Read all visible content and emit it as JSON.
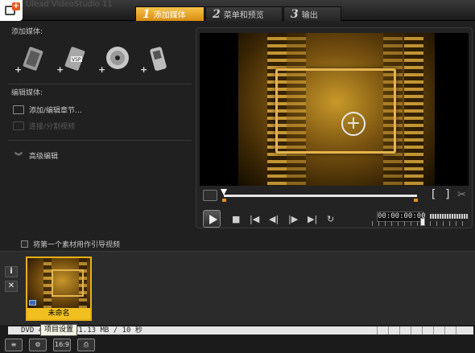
{
  "title_bar": {
    "app_title": "Ulead VideoStudio 11"
  },
  "steps": [
    {
      "num": "1",
      "label": "添加媒体"
    },
    {
      "num": "2",
      "label": "菜单和预览"
    },
    {
      "num": "3",
      "label": "输出"
    }
  ],
  "left_panel": {
    "add_media_label": "添加媒体:",
    "media_buttons": [
      "add-video",
      "add-vsp-project",
      "add-disc",
      "add-mobile-device"
    ],
    "edit_media_label": "编辑媒体:",
    "add_edit_chapters": "添加/编辑章节...",
    "merge_split_video": "连接/分割视频",
    "advanced_edit": "高级编辑"
  },
  "first_clip_checkbox": "将第一个素材用作引导视频",
  "player": {
    "timecode": "00:00:00:00"
  },
  "timeline": {
    "info_btn": "i",
    "delete_btn": "✕",
    "clip_title": "未命名"
  },
  "status": {
    "disc": "DVD 4",
    "usage": "41.13 MB / 10 秒",
    "aspect_btn": "16:9",
    "tooltip": "项目设置"
  },
  "colors": {
    "accent": "#f0a020",
    "clip_label": "#f0c020"
  }
}
